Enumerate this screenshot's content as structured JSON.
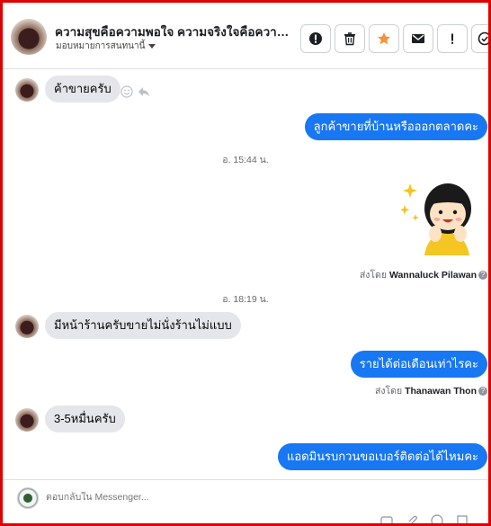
{
  "header": {
    "title": "ความสุขคือความพอใจ ความจริงใจคือความ...",
    "assign_label": "มอบหมายการสนทนานี้",
    "buttons": [
      {
        "name": "spam-button",
        "icon": "alert-circle-icon"
      },
      {
        "name": "delete-button",
        "icon": "trash-icon"
      },
      {
        "name": "star-button",
        "icon": "star-icon"
      },
      {
        "name": "mark-unread-button",
        "icon": "envelope-icon"
      },
      {
        "name": "follow-up-button",
        "icon": "exclamation-icon"
      },
      {
        "name": "done-button",
        "icon": "check-circle-icon"
      }
    ],
    "star_color": "#f7923a"
  },
  "messages": {
    "m1": "ค้าขายครับ",
    "m2": "ลูกค้าขายที่บ้านหรือออกตลาดคะ",
    "ts1": "อ. 15:44 น.",
    "sent_prefix": "ส่งโดย",
    "sender1": "Wannaluck Pilawan",
    "ts2": "อ. 18:19 น.",
    "m3": "มีหน้าร้านครับขายไม่นั่งร้านไม่แบบ",
    "m4": "รายได้ต่อเดือนเท่าไรคะ",
    "sender2": "Thanawan Thon",
    "m5": "3-5หมื่นครับ",
    "m6": "แอดมินรบกวนขอเบอร์ติดต่อได้ไหมคะ"
  },
  "composer": {
    "placeholder": "ตอบกลับใน Messenger..."
  },
  "colors": {
    "outgoing_bubble": "#1877f2",
    "incoming_bubble": "#e4e6eb",
    "frame": "#e00000"
  }
}
